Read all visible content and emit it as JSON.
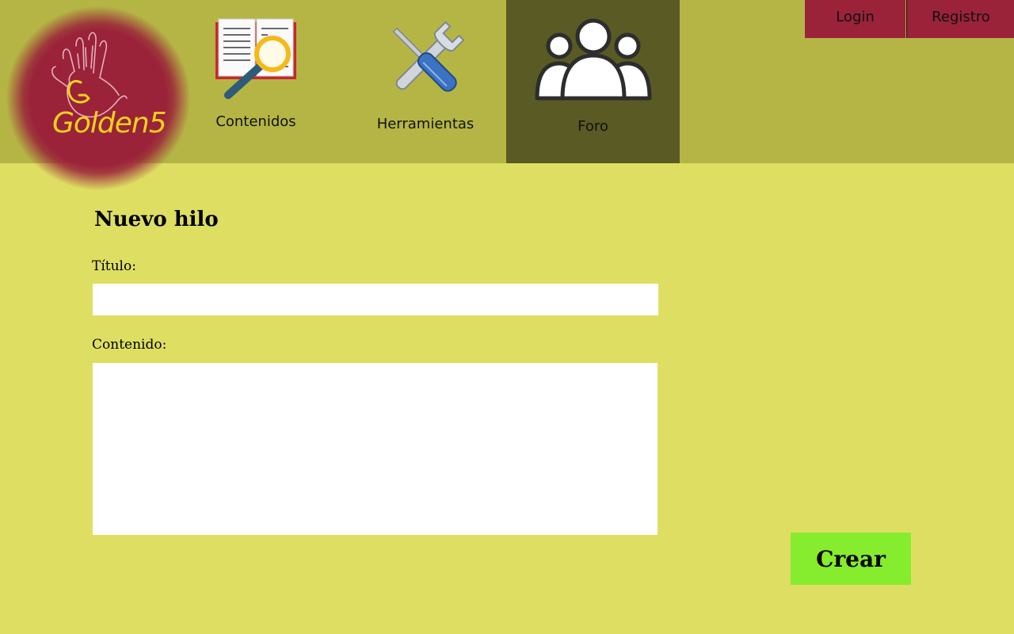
{
  "brand": {
    "name": "Golden5",
    "logo_icon": "handprint-logo-icon",
    "color": "#9a2239",
    "text_color": "#f5d21c"
  },
  "nav": {
    "items": [
      {
        "label": "Contenidos",
        "icon": "book-magnifier-icon"
      },
      {
        "label": "Herramientas",
        "icon": "wrench-screwdriver-icon"
      },
      {
        "label": "Foro",
        "icon": "users-group-icon",
        "active": true
      }
    ]
  },
  "auth": {
    "login_label": "Login",
    "register_label": "Registro"
  },
  "form": {
    "title": "Nuevo hilo",
    "title_field_label": "Título:",
    "title_value": "",
    "content_field_label": "Contenido:",
    "content_value": "",
    "submit_label": "Crear"
  },
  "colors": {
    "header_bg": "#b5b545",
    "page_bg": "#dedf62",
    "active_nav_bg": "#5a5a25",
    "auth_bg": "#9a2239",
    "submit_bg": "#86ec2e"
  }
}
